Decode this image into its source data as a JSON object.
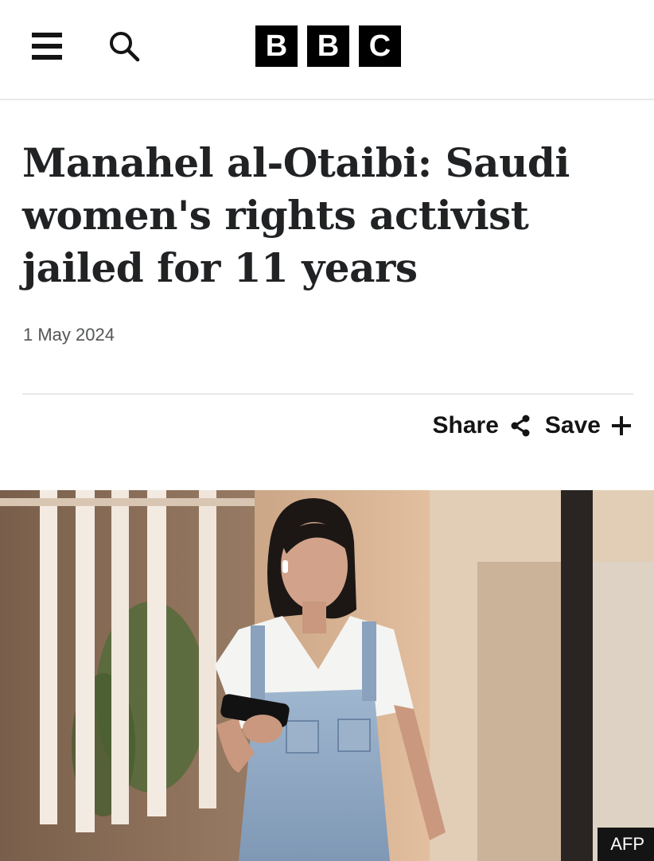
{
  "header": {
    "logo_letters": [
      "B",
      "B",
      "C"
    ],
    "icons": {
      "menu": "menu-icon",
      "search": "search-icon"
    }
  },
  "article": {
    "headline": "Manahel al-Otaibi: Saudi women's rights activist jailed for 11 years",
    "date": "1 May 2024"
  },
  "actions": {
    "share_label": "Share",
    "save_label": "Save",
    "icons": {
      "share": "share-icon",
      "save": "plus-icon"
    }
  },
  "image": {
    "credit": "AFP"
  },
  "colors": {
    "text": "#202224",
    "muted": "#545658",
    "logo_bg": "#000000",
    "divider": "#e6e8ea"
  }
}
